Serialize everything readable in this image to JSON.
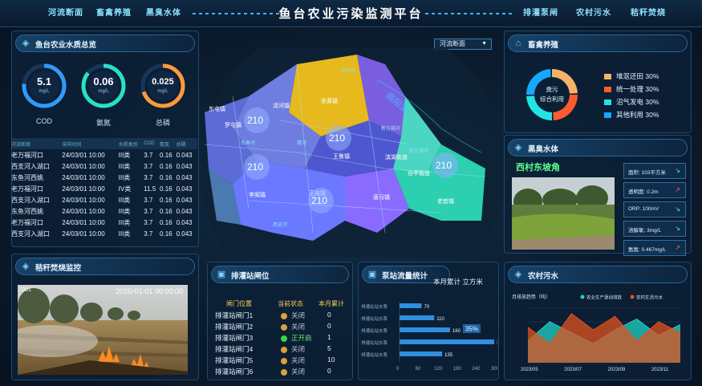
{
  "nav_left": [
    "河流断面",
    "畜禽养殖",
    "黑臭水体"
  ],
  "nav_right": [
    "排灌泵闸",
    "农村污水",
    "秸秆焚烧"
  ],
  "title": "鱼台农业污染监测平台",
  "water_panel": {
    "title": "鱼台农业水质总览",
    "gauges": [
      {
        "value": "5.1",
        "unit": "mg/L",
        "label": "COD",
        "color": "#2e9bff"
      },
      {
        "value": "0.06",
        "unit": "mg/L",
        "label": "氨氮",
        "color": "#27e0c8"
      },
      {
        "value": "0.025",
        "unit": "mg/L",
        "label": "总磷",
        "color": "#ff9a3a"
      }
    ],
    "table_headers": [
      "河流断面",
      "采样时间",
      "水质类别",
      "COD",
      "氨氮",
      "总磷"
    ],
    "rows": [
      {
        "site": "老万福河口",
        "time": "24/03/01 10:00",
        "grade": "III类",
        "cod": "3.7",
        "nh": "0.16",
        "p": "0.043",
        "level": "c3",
        "codbad": false
      },
      {
        "site": "西支河入湖口",
        "time": "24/03/01 10:00",
        "grade": "III类",
        "cod": "3.7",
        "nh": "0.16",
        "p": "0.043",
        "level": "c3",
        "codbad": false
      },
      {
        "site": "东鱼河西姚",
        "time": "24/03/01 10:00",
        "grade": "III类",
        "cod": "3.7",
        "nh": "0.16",
        "p": "0.043",
        "level": "c3",
        "codbad": false
      },
      {
        "site": "老万福河口",
        "time": "24/03/01 10:00",
        "grade": "IV类",
        "cod": "11.5",
        "nh": "0.16",
        "p": "0.043",
        "level": "c4",
        "codbad": true
      },
      {
        "site": "西支河入湖口",
        "time": "24/03/01 10:00",
        "grade": "III类",
        "cod": "3.7",
        "nh": "0.16",
        "p": "0.043",
        "level": "c3",
        "codbad": false
      },
      {
        "site": "东鱼河西姚",
        "time": "24/03/01 10:00",
        "grade": "III类",
        "cod": "3.7",
        "nh": "0.16",
        "p": "0.043",
        "level": "c3",
        "codbad": false
      },
      {
        "site": "老万福河口",
        "time": "24/03/01 10:00",
        "grade": "III类",
        "cod": "3.7",
        "nh": "0.16",
        "p": "0.043",
        "level": "c3",
        "codbad": false
      },
      {
        "site": "西支河入湖口",
        "time": "24/03/01 10:00",
        "grade": "III类",
        "cod": "3.7",
        "nh": "0.16",
        "p": "0.043",
        "level": "c3",
        "codbad": false
      }
    ]
  },
  "map": {
    "dropdown": "河流断面",
    "towns": [
      "清河镇",
      "张黄镇",
      "罗屯镇",
      "王鲁镇",
      "滨湖街道",
      "谷亭街道",
      "唐马镇",
      "老砦镇",
      "王庙镇",
      "李阁镇",
      "东屯镇"
    ],
    "rivers": [
      "东鱼河",
      "新万福河",
      "老万福河",
      "白马河",
      "西支河",
      "惠河"
    ],
    "lake": "南阳湖",
    "markers": [
      "210",
      "210",
      "210",
      "210",
      "210"
    ]
  },
  "livestock": {
    "title": "畜禽养殖",
    "center_label_1": "粪污",
    "center_label_2": "综合利用",
    "legend": [
      {
        "label": "堆沤还田 30%",
        "color": "#f5b36a",
        "value": 30
      },
      {
        "label": "统一处理 30%",
        "color": "#ff5b2e",
        "value": 30
      },
      {
        "label": "沼气发电 30%",
        "color": "#22e3e3",
        "value": 30
      },
      {
        "label": "其他利用 30%",
        "color": "#16a7ff",
        "value": 30
      }
    ]
  },
  "blackwater": {
    "title": "黑臭水体",
    "site": "西村东坡角",
    "metrics": [
      {
        "label": "面积: 103平方米",
        "trend": "down"
      },
      {
        "label": "透明度: 0.2m",
        "trend": "up"
      },
      {
        "label": "ORP: 100mV",
        "trend": "down"
      },
      {
        "label": "溶解氧: 3mg/L",
        "trend": "down"
      },
      {
        "label": "氨氮: 0.467mg/L",
        "trend": "up"
      }
    ]
  },
  "straw": {
    "title": "秸秆焚烧监控",
    "timestamp": "2020-01-01 00:00:00",
    "cam": "D01"
  },
  "gates": {
    "title": "排灌站闸位",
    "headers": [
      "闸门位置",
      "当前状态",
      "本月累计"
    ],
    "rows": [
      {
        "name": "排灌站闸门1",
        "state": "关闭",
        "on": false,
        "count": "0"
      },
      {
        "name": "排灌站闸门2",
        "state": "关闭",
        "on": false,
        "count": "0"
      },
      {
        "name": "排灌站闸门3",
        "state": "正开启",
        "on": true,
        "count": "1"
      },
      {
        "name": "排灌站闸门4",
        "state": "关闭",
        "on": false,
        "count": "5"
      },
      {
        "name": "排灌站闸门5",
        "state": "关闭",
        "on": false,
        "count": "10"
      },
      {
        "name": "排灌站闸门6",
        "state": "关闭",
        "on": false,
        "count": "0"
      }
    ]
  },
  "pump": {
    "title": "泵站流量统计",
    "subtitle": "本月累计 立方米"
  },
  "rural": {
    "title": "农村污水"
  },
  "chart_data": [
    {
      "type": "bar",
      "orientation": "horizontal",
      "categories": [
        "排灌站站水泵",
        "排灌站站水泵",
        "排灌站站水泵",
        "排灌站站水泵",
        "排灌站站水泵"
      ],
      "values": [
        70,
        110,
        160,
        315,
        135
      ],
      "xlim": [
        0,
        300
      ],
      "xticks": [
        0,
        60,
        120,
        180,
        240,
        300
      ],
      "annotation": "35%",
      "grid": false
    },
    {
      "type": "area",
      "ylabel": "月排放趋势（吨）",
      "x": [
        "2023/05",
        "2023/06",
        "2023/07",
        "2023/08",
        "2023/09",
        "2023/10",
        "2023/11",
        "2023/12"
      ],
      "xtick_labels": [
        "2023/05",
        "2023/07",
        "2023/09",
        "2023/11"
      ],
      "series": [
        {
          "name": "农业生产源动排放",
          "color": "#22d3c5",
          "values": [
            40,
            75,
            55,
            35,
            60,
            80,
            50,
            70
          ]
        },
        {
          "name": "农村生活污水",
          "color": "#e0531f",
          "values": [
            65,
            35,
            90,
            60,
            85,
            40,
            75,
            55
          ]
        }
      ],
      "ylim": [
        0,
        100
      ],
      "legend": "top-right",
      "grid": true
    }
  ]
}
